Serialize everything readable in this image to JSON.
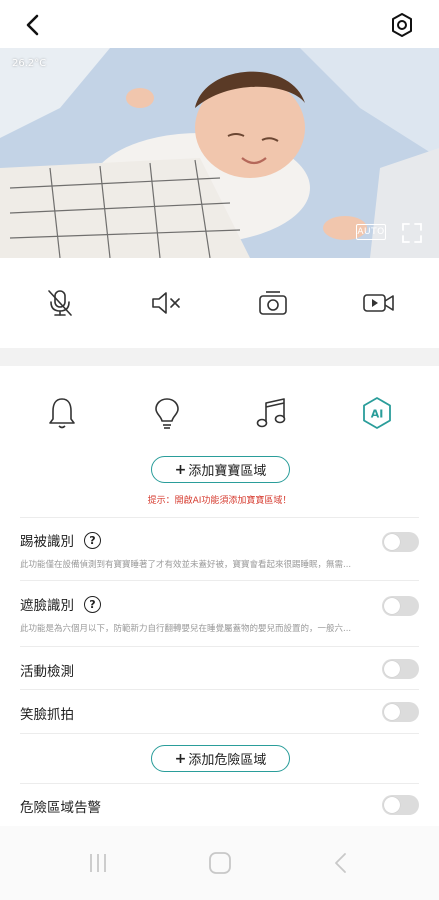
{
  "camera": {
    "temperature": "26.2°C",
    "quality_badge": "AUTO"
  },
  "controls": [
    {
      "icon": "mic-off-icon"
    },
    {
      "icon": "speaker-mute-icon"
    },
    {
      "icon": "snapshot-icon"
    },
    {
      "icon": "record-video-icon"
    }
  ],
  "features": [
    {
      "icon": "bell-icon"
    },
    {
      "icon": "lightbulb-icon"
    },
    {
      "icon": "music-icon"
    },
    {
      "icon": "ai-icon",
      "label": "AI",
      "active": true
    }
  ],
  "baby_zone": {
    "button_label": "添加寶寶區域",
    "hint": "提示：開啟AI功能須添加寶寶區域！"
  },
  "settings": [
    {
      "title": "踢被識別",
      "description": "此功能僅在設備偵測到有寶寶睡著了才有效並未蓋好被，寶寶會看起來很踢睡眠，無需...",
      "help": "?",
      "enabled": false
    },
    {
      "title": "遮臉識別",
      "description": "此功能是為六個月以下，防範新力自行翻轉嬰兒在睡覺屬蓋物的嬰兒而設置的，一般六...",
      "help": "?",
      "enabled": false
    },
    {
      "title": "活動檢測",
      "enabled": false
    },
    {
      "title": "笑臉抓拍",
      "enabled": false
    }
  ],
  "danger_zone": {
    "button_label": "添加危險區域",
    "alert_title": "危險區域告警",
    "alert_enabled": false
  },
  "colors": {
    "accent": "#2a9d9a",
    "warning": "#d63b2f",
    "toggle_off": "#dcdcdc"
  }
}
